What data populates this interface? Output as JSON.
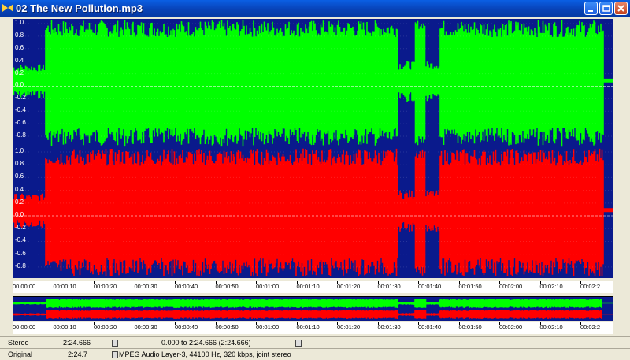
{
  "window": {
    "title": "02 The New Pollution.mp3"
  },
  "waveform": {
    "channels": [
      {
        "name": "left",
        "color": "#00ff00"
      },
      {
        "name": "right",
        "color": "#ff0000"
      }
    ],
    "background": "#0a1a8c",
    "y_labels": [
      "1.0",
      "0.8",
      "0.6",
      "0.4",
      "0.2",
      "0.0",
      "-0.2",
      "-0.4",
      "-0.6",
      "-0.8"
    ]
  },
  "timeline": {
    "labels": [
      "00:00:00",
      "00:00:10",
      "00:00:20",
      "00:00:30",
      "00:00:40",
      "00:00:50",
      "00:01:00",
      "00:01:10",
      "00:01:20",
      "00:01:30",
      "00:01:40",
      "00:01:50",
      "00:02:00",
      "00:02:10",
      "00:02:2"
    ]
  },
  "status": {
    "row1": {
      "mode": "Stereo",
      "duration": "2:24.666",
      "selection": "0.000 to 2:24.666 (2:24.666)"
    },
    "row2": {
      "label": "Original",
      "duration": "2:24.7",
      "format": "MPEG Audio Layer-3, 44100 Hz, 320 kbps, joint stereo"
    }
  }
}
